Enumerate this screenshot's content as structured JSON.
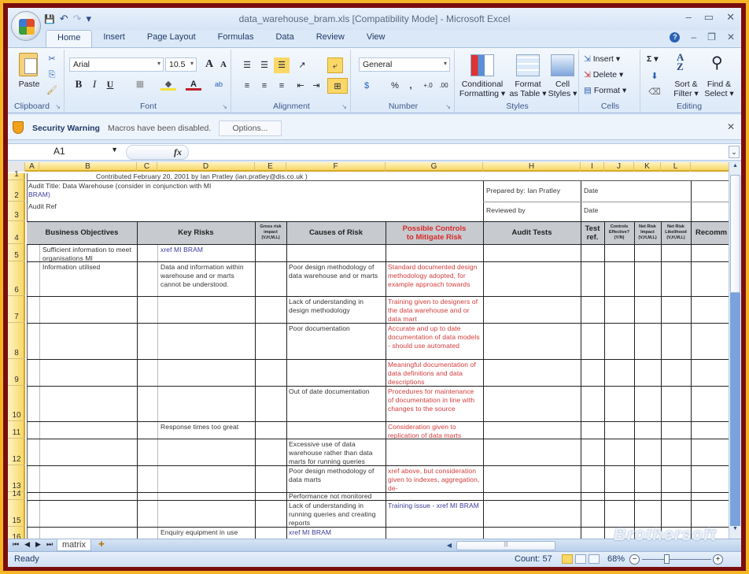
{
  "window": {
    "title": "data_warehouse_bram.xls  [Compatibility Mode] - Microsoft Excel",
    "controls": [
      "–",
      "▭",
      "✕"
    ],
    "doc_controls": [
      "–",
      "❐",
      "✕"
    ]
  },
  "quick_access": {
    "save": "💾",
    "undo": "↶",
    "redo": "↷",
    "customize": "▾"
  },
  "tabs": [
    "Home",
    "Insert",
    "Page Layout",
    "Formulas",
    "Data",
    "Review",
    "View"
  ],
  "active_tab": "Home",
  "ribbon": {
    "clipboard": {
      "label": "Clipboard",
      "paste": "Paste"
    },
    "font": {
      "label": "Font",
      "name": "Arial",
      "size": "10.5",
      "bold": "B",
      "italic": "I",
      "underline": "U",
      "grow": "A",
      "shrink": "A"
    },
    "alignment": {
      "label": "Alignment"
    },
    "number": {
      "label": "Number",
      "format": "General",
      "percent": "%",
      "comma": ",",
      "inc_decimal": "+.0",
      "dec_decimal": ".00"
    },
    "styles": {
      "label": "Styles",
      "conditional": "Conditional\nFormatting ▾",
      "format_table": "Format\nas Table ▾",
      "cell_styles": "Cell\nStyles ▾"
    },
    "cells": {
      "label": "Cells",
      "insert": "Insert ▾",
      "delete": "Delete ▾",
      "format": "Format ▾"
    },
    "editing": {
      "label": "Editing",
      "sum": "Σ ▾",
      "sort": "Sort &\nFilter ▾",
      "find": "Find &\nSelect ▾"
    }
  },
  "security": {
    "title": "Security Warning",
    "message": "Macros have been disabled.",
    "options": "Options..."
  },
  "formula_bar": {
    "name_box": "A1",
    "fx": "fx",
    "formula": ""
  },
  "columns": [
    "A",
    "B",
    "C",
    "D",
    "E",
    "F",
    "G",
    "H",
    "I",
    "J",
    "K",
    "L"
  ],
  "rows": [
    "1",
    "2",
    "3",
    "4",
    "5",
    "6",
    "7",
    "8",
    "9",
    "10",
    "11",
    "12",
    "13",
    "14",
    "15",
    "16"
  ],
  "sheet": {
    "r1": "Contributed February 20, 2001 by Ian Pratley (ian.pratley@dis.co.uk )",
    "audit_title": "Audit Title:  Data Warehouse (consider in conjunction with MI",
    "audit_title_2": "BRAM)",
    "audit_ref": "Audit Ref",
    "prepared_by": "Prepared by: Ian Pratley",
    "reviewed_by": "Reviewed by",
    "date1": "Date",
    "date2": "Date",
    "headers": {
      "business_objectives": "Business Objectives",
      "key_risks": "Key Risks",
      "gross_risk": "Gross risk impact (V,H,M,L)",
      "causes": "Causes of Risk",
      "controls": "Possible Controls to Mitigate Risk",
      "audit_tests": "Audit Tests",
      "test_ref": "Test ref.",
      "controls_effective": "Controls Effective? (Y/N)",
      "net_impact": "Net Risk Impact (V,H,M,L)",
      "net_likelihood": "Net Risk Likelihood (V,H,M,L)",
      "recomm": "Recomm"
    },
    "r5": {
      "b": "Sufficient information to meet organisations MI",
      "d": "xref MI BRAM"
    },
    "r6": {
      "b": "Information utilised",
      "d": "Data and information within warehouse and or marts cannot be understood.",
      "f": "Poor design methodology of data warehouse and or marts",
      "g": "Standard documented design methodology adopted, for example approach towards"
    },
    "r7": {
      "f": "Lack of understanding in design methodology",
      "g": "Training given to designers of the data warehouse and or data mart"
    },
    "r8": {
      "f": "Poor documentation",
      "g": "Accurate and up to date documentation of data models\n- should use automated"
    },
    "r9": {
      "g": "Meaningful documentation of data definitions and data descriptions"
    },
    "r10": {
      "f": "Out of date documentation",
      "g": "Procedures for maintenance of documentation in line with changes to the source"
    },
    "r11": {
      "d": "Response times too great",
      "g": "Consideration given to replication of data marts"
    },
    "r12": {
      "f": "Excessive use of data warehouse rather than data marts for running queries"
    },
    "r13": {
      "f": "Poor design methodology of data marts",
      "g": "xref above, but consideration given to indexes, aggregation, de-"
    },
    "r14": {
      "f": "Performance not monitored"
    },
    "r15": {
      "f": "Lack of understanding in running queries and creating reports",
      "g": "Training issue - xref MI BRAM"
    },
    "r16": {
      "d": "Enquiry equipment in use",
      "f": "xref MI BRAM"
    }
  },
  "sheet_tabs": [
    "matrix"
  ],
  "status": {
    "ready": "Ready",
    "count": "Count: 57",
    "zoom": "68%"
  },
  "watermark": "Brothersoft"
}
